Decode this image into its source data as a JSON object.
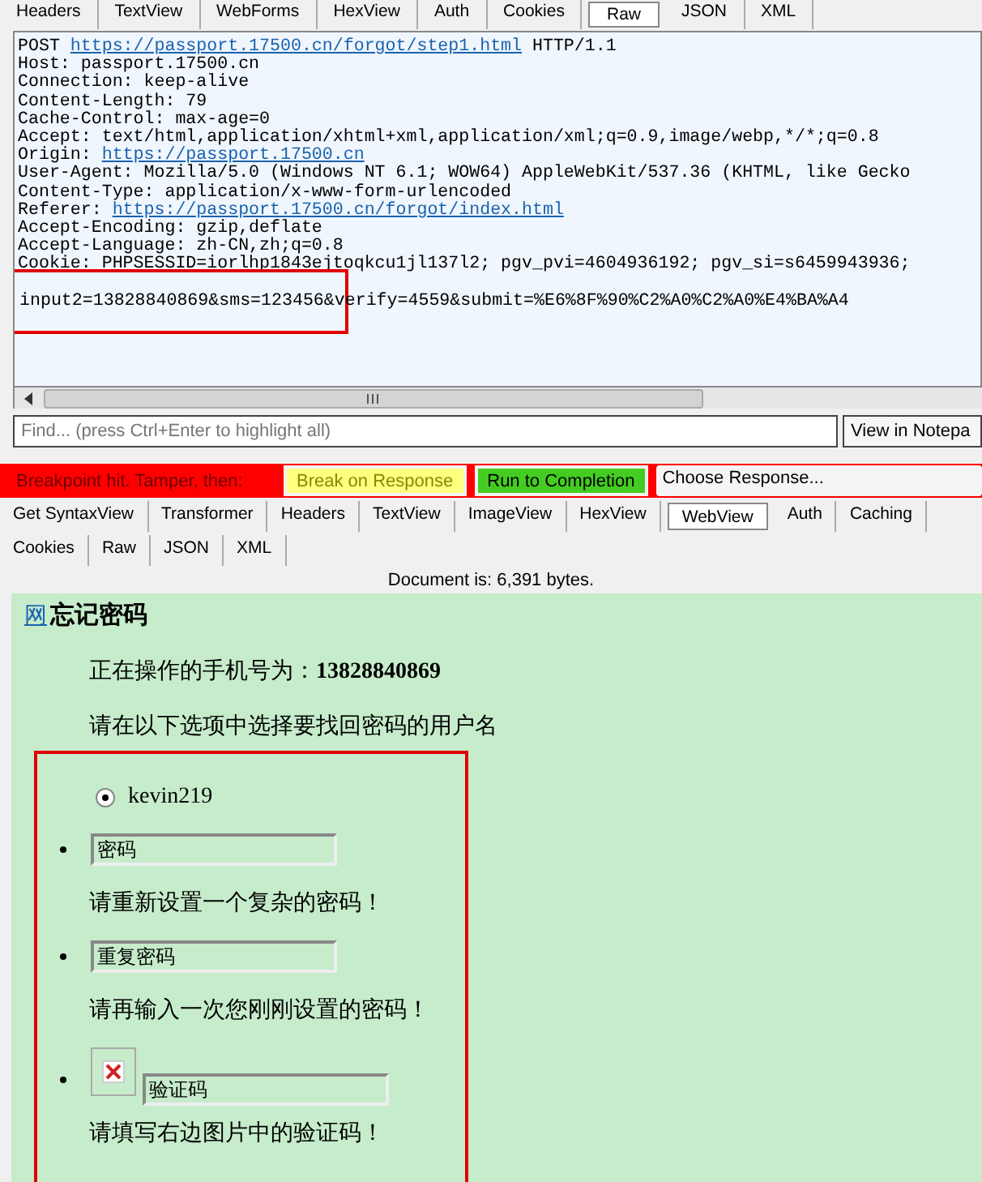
{
  "request_tabs": [
    {
      "label": "Headers",
      "selected": false
    },
    {
      "label": "TextView",
      "selected": false
    },
    {
      "label": "WebForms",
      "selected": false
    },
    {
      "label": "HexView",
      "selected": false
    },
    {
      "label": "Auth",
      "selected": false
    },
    {
      "label": "Cookies",
      "selected": false
    },
    {
      "label": "Raw",
      "selected": true
    },
    {
      "label": "JSON",
      "selected": false
    },
    {
      "label": "XML",
      "selected": false
    }
  ],
  "raw_lines": [
    {
      "text": "POST ",
      "link": "https://passport.17500.cn/forgot/step1.html",
      "after": " HTTP/1.1"
    },
    {
      "text": "Host: passport.17500.cn"
    },
    {
      "text": "Connection: keep-alive"
    },
    {
      "text": "Content-Length: 79"
    },
    {
      "text": "Cache-Control: max-age=0"
    },
    {
      "text": "Accept: text/html,application/xhtml+xml,application/xml;q=0.9,image/webp,*/*;q=0.8"
    },
    {
      "text": "Origin: ",
      "link": "https://passport.17500.cn"
    },
    {
      "text": "User-Agent: Mozilla/5.0 (Windows NT 6.1; WOW64) AppleWebKit/537.36 (KHTML, like Gecko"
    },
    {
      "text": "Content-Type: application/x-www-form-urlencoded"
    },
    {
      "text": "Referer: ",
      "link": "https://passport.17500.cn/forgot/index.html"
    },
    {
      "text": "Accept-Encoding: gzip,deflate"
    },
    {
      "text": "Accept-Language: zh-CN,zh;q=0.8"
    },
    {
      "text": "Cookie: PHPSESSID=iorlhp1843ejtoqkcu1jl137l2; pgv_pvi=4604936192; pgv_si=s6459943936;"
    }
  ],
  "body": {
    "text": "input2=13828840869&sms=123456&verify=4559&submit=%E6%8F%90%C2%A0%C2%A0%E4%BA%A4",
    "highlighted": true
  },
  "find": {
    "placeholder": "Find... (press Ctrl+Enter to highlight all)"
  },
  "notepad_button": "View in Notepa",
  "breakpoint": {
    "label": "Breakpoint hit. Tamper, then:",
    "buttons": [
      {
        "label": "Break on Response",
        "color": "#ffff80"
      },
      {
        "label": "Run to Completion",
        "color": "#44cc22"
      }
    ],
    "choose": "Choose Response..."
  },
  "response_tabs": [
    [
      {
        "label": "Get SyntaxView",
        "selected": false
      },
      {
        "label": "Transformer",
        "selected": false
      },
      {
        "label": "Headers",
        "selected": false
      },
      {
        "label": "TextView",
        "selected": false
      },
      {
        "label": "ImageView",
        "selected": false
      },
      {
        "label": "HexView",
        "selected": false
      },
      {
        "label": "WebView",
        "selected": true
      },
      {
        "label": "Auth",
        "selected": false
      },
      {
        "label": "Caching",
        "selected": false
      }
    ],
    [
      {
        "label": "Cookies",
        "selected": false
      },
      {
        "label": "Raw",
        "selected": false
      },
      {
        "label": "JSON",
        "selected": false
      },
      {
        "label": "XML",
        "selected": false
      }
    ]
  ],
  "document_info": "Document is: 6,391 bytes.",
  "webview": {
    "nav_link": "网",
    "heading": "忘记密码",
    "phone_line": "正在操作的手机号为：**13828840869**",
    "prompt": "请在以下选项中选择要找回密码的用户名",
    "highlighted": true,
    "username": {
      "label": "kevin219",
      "selected": true
    },
    "fields": [
      {
        "kind": "text",
        "value": "密码",
        "hint": "请重新设置一个复杂的密码！"
      },
      {
        "kind": "text",
        "value": "重复密码",
        "hint": "请再输入一次您刚刚设置的密码！"
      },
      {
        "kind": "captcha",
        "value": "验证码",
        "hint": "请填写右边图片中的验证码！"
      }
    ]
  }
}
